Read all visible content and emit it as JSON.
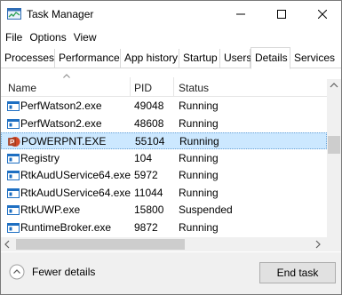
{
  "window": {
    "title": "Task Manager"
  },
  "menu": [
    "File",
    "Options",
    "View"
  ],
  "tabs": [
    {
      "label": "Processes",
      "active": false
    },
    {
      "label": "Performance",
      "active": false
    },
    {
      "label": "App history",
      "active": false
    },
    {
      "label": "Startup",
      "active": false
    },
    {
      "label": "Users",
      "active": false
    },
    {
      "label": "Details",
      "active": true
    },
    {
      "label": "Services",
      "active": false
    }
  ],
  "columns": {
    "name": "Name",
    "pid": "PID",
    "status": "Status"
  },
  "rows": [
    {
      "name": "PerfWatson2.exe",
      "pid": "49048",
      "status": "Running",
      "icon": "app-window-icon",
      "selected": false
    },
    {
      "name": "PerfWatson2.exe",
      "pid": "48608",
      "status": "Running",
      "icon": "app-window-icon",
      "selected": false
    },
    {
      "name": "POWERPNT.EXE",
      "pid": "55104",
      "status": "Running",
      "icon": "powerpoint-icon",
      "selected": true
    },
    {
      "name": "Registry",
      "pid": "104",
      "status": "Running",
      "icon": "app-window-icon",
      "selected": false
    },
    {
      "name": "RtkAudUService64.exe",
      "pid": "5972",
      "status": "Running",
      "icon": "app-window-icon",
      "selected": false
    },
    {
      "name": "RtkAudUService64.exe",
      "pid": "11044",
      "status": "Running",
      "icon": "app-window-icon",
      "selected": false
    },
    {
      "name": "RtkUWP.exe",
      "pid": "15800",
      "status": "Suspended",
      "icon": "app-window-icon",
      "selected": false
    },
    {
      "name": "RuntimeBroker.exe",
      "pid": "9872",
      "status": "Running",
      "icon": "app-window-icon",
      "selected": false
    }
  ],
  "footer": {
    "fewer_details": "Fewer details",
    "end_task": "End task"
  },
  "colors": {
    "selection": "#cce8ff",
    "powerpoint": "#d24726",
    "app_icon": "#1e6fc2"
  }
}
